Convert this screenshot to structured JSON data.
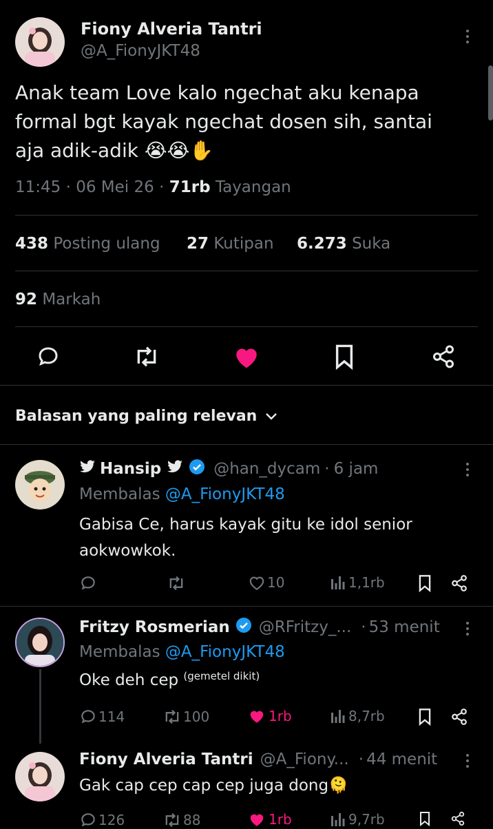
{
  "main_post": {
    "author_name": "Fiony Alveria Tantri",
    "author_handle": "@A_FionyJKT48",
    "text_line1": "Anak team Love kalo ngechat aku kenapa",
    "text_line2": "formal bgt kayak ngechat dosen sih, santai",
    "text_line3": "aja adik-adik",
    "emoji": "😭😭✋",
    "time": "11:45",
    "date": "06 Mei 26",
    "views_count": "71rb",
    "views_label": "Tayangan",
    "reposts_count": "438",
    "reposts_label": "Posting ulang",
    "quotes_count": "27",
    "quotes_label": "Kutipan",
    "likes_count": "6.273",
    "likes_label": "Suka",
    "bookmarks_count": "92",
    "bookmarks_label": "Markah"
  },
  "sort": {
    "label": "Balasan yang paling relevan"
  },
  "colors": {
    "accent": "#1d9bf0",
    "like": "#f91880",
    "muted": "#71767b",
    "text": "#e7e9ea",
    "bg": "#000000"
  },
  "replies": [
    {
      "name": "Hansip",
      "handle": "@han_dycam",
      "time": "6 jam",
      "replying_prefix": "Membalas",
      "replying_to": "@A_FionyJKT48",
      "text_line1": "Gabisa Ce, harus kayak gitu ke idol senior",
      "text_line2": "aokwowkok.",
      "replies": "",
      "reposts": "",
      "likes": "10",
      "views": "1,1rb"
    },
    {
      "name": "Fritzy Rosmerian",
      "handle": "@RFritzy_...",
      "time": "53 menit",
      "replying_prefix": "Membalas",
      "replying_to": "@A_FionyJKT48",
      "text_line1": "Oke deh cep",
      "text_small": "(gemetel dikit)",
      "replies": "114",
      "reposts": "100",
      "likes": "1rb",
      "views": "8,7rb"
    },
    {
      "name": "Fiony Alveria Tantri",
      "handle": "@A_Fiony...",
      "time": "44 menit",
      "text_line1": "Gak cap cep cap cep juga dong",
      "emoji": "🫠",
      "replies": "126",
      "reposts": "88",
      "likes": "1rb",
      "views": "9,7rb"
    }
  ]
}
